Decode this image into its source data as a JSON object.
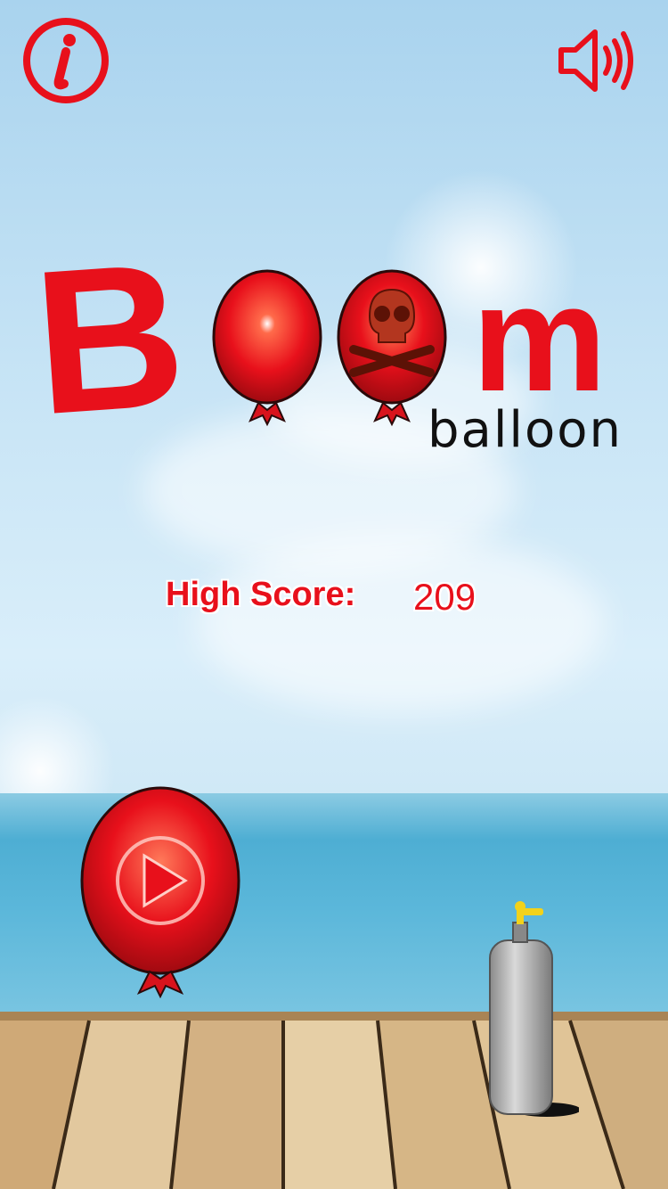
{
  "title": {
    "main_big": "B",
    "main_end": "m",
    "subtitle": "balloon"
  },
  "high_score": {
    "label": "High Score:",
    "value": "209"
  },
  "icons": {
    "info": "info-icon",
    "sound": "speaker-icon",
    "play": "play-icon",
    "tank": "gas-tank-icon",
    "skull": "skull-icon"
  },
  "colors": {
    "accent": "#e8101b",
    "sky": "#c5e3f5",
    "sea": "#4eaed3",
    "deck": "#d9bb8c"
  }
}
